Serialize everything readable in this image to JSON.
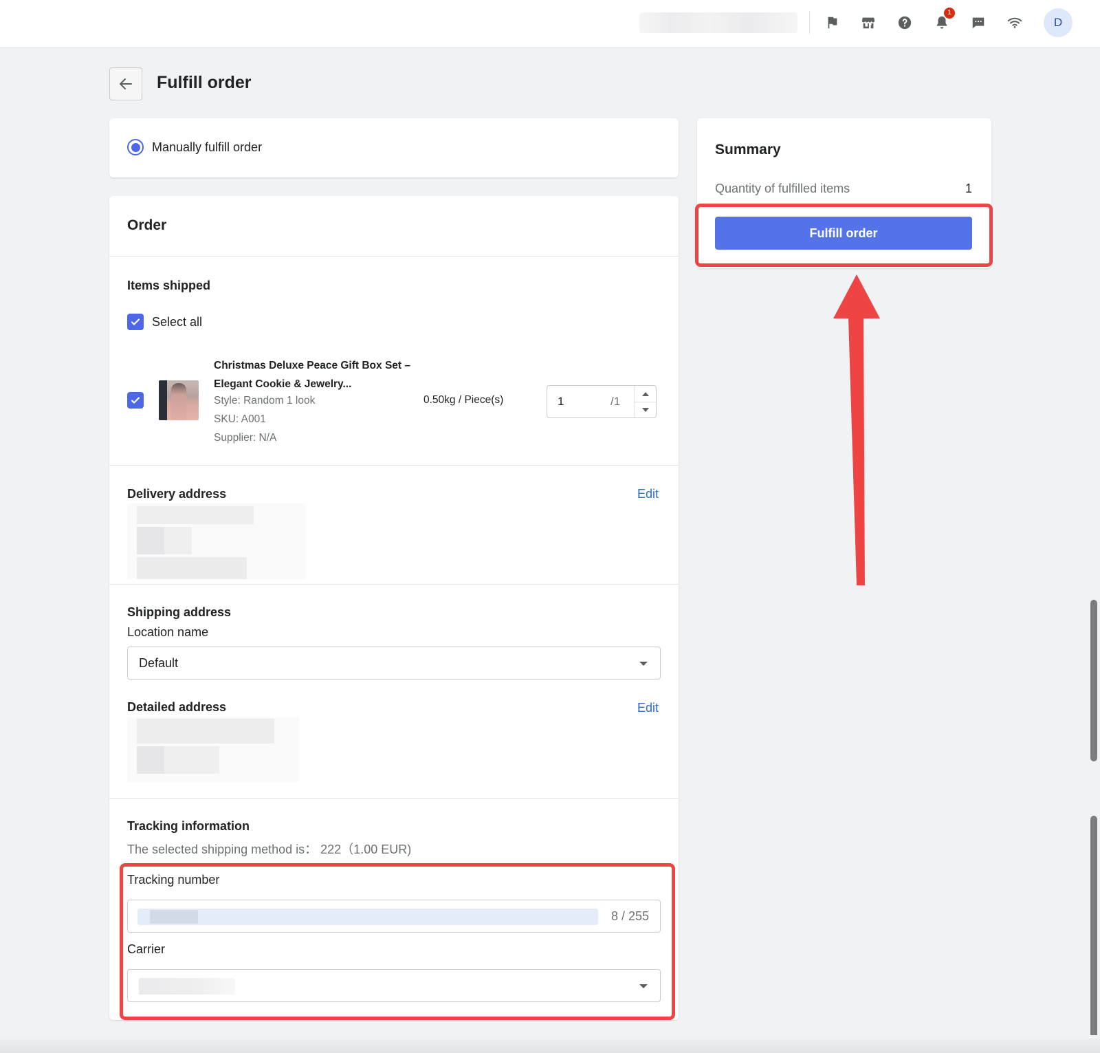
{
  "topbar": {
    "icons": [
      "flag-icon",
      "store-icon",
      "help-icon",
      "bell-icon",
      "chat-icon",
      "wifi-icon"
    ],
    "notification_count": "1",
    "avatar_initial": "D"
  },
  "page": {
    "title": "Fulfill order"
  },
  "fulfill_method": {
    "label": "Manually fulfill order",
    "selected": true
  },
  "order": {
    "title": "Order",
    "items_shipped": {
      "heading": "Items shipped",
      "select_all_label": "Select all",
      "items": [
        {
          "name": "Christmas Deluxe Peace Gift Box Set – Elegant Cookie & Jewelry...",
          "style": "Style: Random 1 look",
          "sku": "SKU: A001",
          "supplier": "Supplier: N/A",
          "weight": "0.50kg / Piece(s)",
          "quantity": "1",
          "max_quantity": "/1",
          "checked": true
        }
      ]
    },
    "delivery_address": {
      "heading": "Delivery address",
      "edit_label": "Edit"
    },
    "shipping_address": {
      "heading": "Shipping address",
      "location_label": "Location name",
      "location_value": "Default",
      "detailed_heading": "Detailed address",
      "edit_label": "Edit"
    },
    "tracking": {
      "heading": "Tracking information",
      "shipping_method": "The selected shipping method is： 222（1.00 EUR)",
      "number_label": "Tracking number",
      "char_count": "8 / 255",
      "carrier_label": "Carrier"
    }
  },
  "summary": {
    "title": "Summary",
    "qty_label": "Quantity of fulfilled items",
    "qty_value": "1",
    "button_label": "Fulfill order"
  },
  "colors": {
    "accent": "#5473e8",
    "highlight": "#ef4444",
    "link": "#2c6ecb"
  }
}
